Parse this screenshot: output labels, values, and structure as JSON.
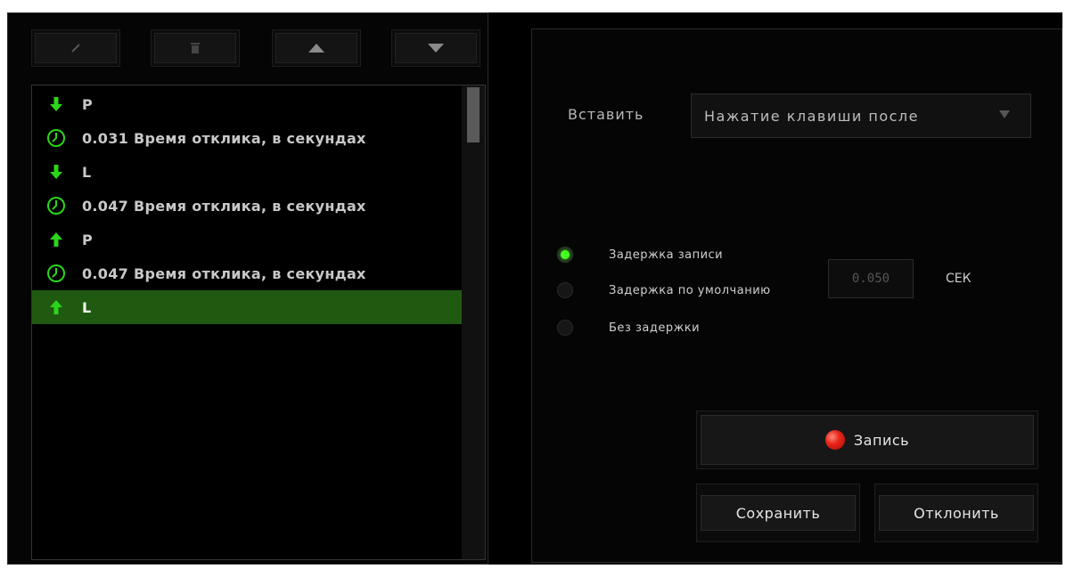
{
  "toolbar": {
    "edit_icon": "pencil-icon",
    "delete_icon": "trash-icon",
    "move_up_icon": "arrow-up-icon",
    "move_down_icon": "arrow-down-icon"
  },
  "macro_list": {
    "items": [
      {
        "icon": "key-down-arrow-icon",
        "text": "P"
      },
      {
        "icon": "clock-icon",
        "text": "0.031 Время отклика, в секундах"
      },
      {
        "icon": "key-down-arrow-icon",
        "text": "L"
      },
      {
        "icon": "clock-icon",
        "text": "0.047 Время отклика, в секундах"
      },
      {
        "icon": "key-up-arrow-icon",
        "text": "P"
      },
      {
        "icon": "clock-icon",
        "text": "0.047 Время отклика, в секундах"
      },
      {
        "icon": "key-up-arrow-icon",
        "text": "L",
        "selected": true
      }
    ]
  },
  "insert": {
    "label": "Вставить",
    "selected_value": "Нажатие клавиши после"
  },
  "delay_options": [
    {
      "label": "Задержка записи",
      "checked": true
    },
    {
      "label": "Задержка по умолчанию",
      "checked": false
    },
    {
      "label": "Без задержки",
      "checked": false
    }
  ],
  "default_delay": {
    "value": "0.050",
    "unit": "СЕК"
  },
  "buttons": {
    "record": "Запись",
    "save": "Сохранить",
    "cancel": "Отклонить"
  },
  "colors": {
    "accent_green": "#44ff22",
    "selected_row": "#1f5a10",
    "record_red": "#e8251a"
  }
}
